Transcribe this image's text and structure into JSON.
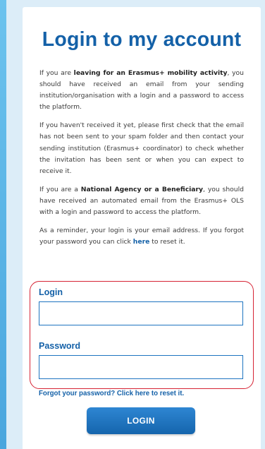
{
  "title": "Login to my account",
  "intro": {
    "p1": {
      "text_a": "If you are ",
      "bold": "leaving for an Erasmus+ mobility activity",
      "text_b": ", you should have received an email from your sending institution/organisation with a login and a password to access the platform."
    },
    "p2": {
      "text": "If you haven't received it yet, please first check that the email has not been sent to your spam folder and then contact your sending institution (Erasmus+ coordinator) to check whether the invitation has been sent or when you can expect to receive it."
    },
    "p3": {
      "text_a": "If you are a ",
      "bold": "National Agency or a Beneficiary",
      "text_b": ", you should have received an automated email from the Erasmus+ OLS with a login and password to access the platform."
    },
    "p4": {
      "text_a": "As a reminder, your login is your email address. If you forgot your password you can click ",
      "link": "here",
      "text_b": " to reset it."
    }
  },
  "form": {
    "login_label": "Login",
    "login_value": "",
    "password_label": "Password",
    "password_value": "",
    "forgot_link": "Forgot your password? Click here to reset it.",
    "submit_label": "LOGIN"
  },
  "colors": {
    "brand_blue": "#1461a8",
    "highlight_red": "#d62334",
    "page_bg": "#dcedf8",
    "accent_band": "#4aa6de"
  }
}
